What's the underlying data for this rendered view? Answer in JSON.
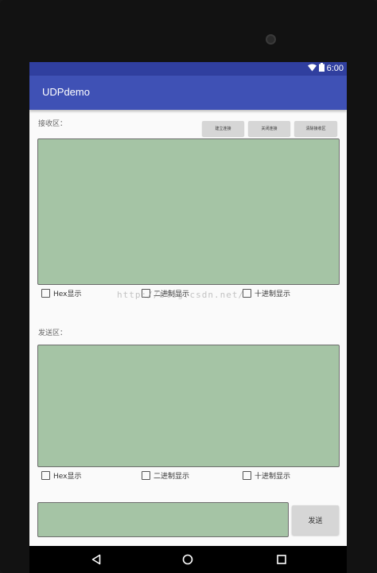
{
  "status_bar": {
    "time": "6:00",
    "wifi_icon": "wifi-icon",
    "battery_icon": "battery-icon"
  },
  "app_bar": {
    "title": "UDPdemo"
  },
  "receive": {
    "label": "接收区：",
    "buttons": [
      "建立连接",
      "关闭连接",
      "清除接收区"
    ],
    "checkboxes": [
      "Hex显示",
      "二进制显示",
      "十进制显示"
    ]
  },
  "watermark": "http://blog.csdn.net/",
  "send": {
    "label": "发送区：",
    "checkboxes": [
      "Hex显示",
      "二进制显示",
      "十进制显示"
    ],
    "input_value": "",
    "send_button": "发送"
  },
  "nav_bar": {
    "back_icon": "back-triangle-icon",
    "home_icon": "home-circle-icon",
    "recents_icon": "recents-square-icon"
  },
  "colors": {
    "status_bar": "#303f9f",
    "app_bar": "#3f51b5",
    "text_area": "#a5c4a5"
  }
}
